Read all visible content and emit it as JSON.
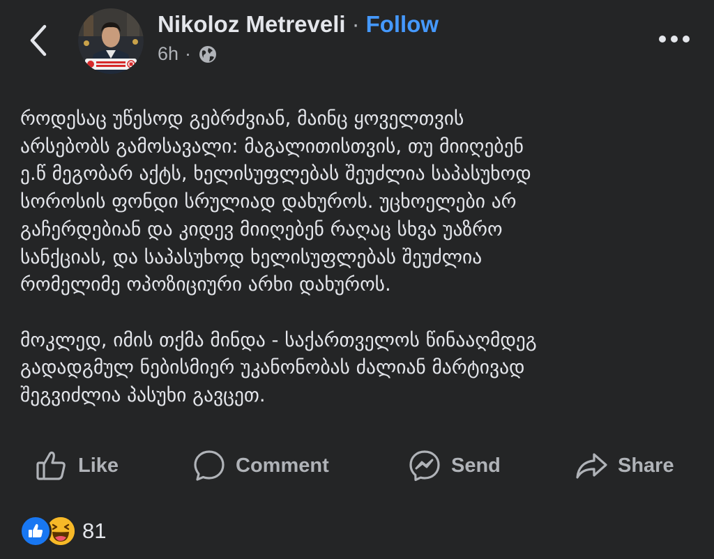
{
  "header": {
    "author_name": "Nikoloz Metreveli",
    "separator": "·",
    "follow_label": "Follow",
    "time": "6h",
    "meta_separator": "·",
    "back_icon": "chevron-left-icon",
    "privacy_icon": "globe-icon",
    "more_icon": "more-horizontal-icon",
    "avatar_badge_text": "ევროპისკენ"
  },
  "post": {
    "paragraphs": [
      "როდესაც უწესოდ გებრძვიან, მაინც ყოველთვის\nარსებობს გამოსავალი: მაგალითისთვის, თუ მიიღებენ\nე.წ მეგობარ აქტს, ხელისუფლებას შეუძლია საპასუხოდ\nსოროსის ფონდი სრულიად დახუროს. უცხოელები არ\nგაჩერდებიან და კიდევ მიიღებენ რაღაც სხვა უაზრო\nსანქციას, და საპასუხოდ ხელისუფლებას შეუძლია\nრომელიმე ოპოზიციური არხი დახუროს.",
      "მოკლედ, იმის თქმა მინდა - საქართველოს წინააღმდეგ\nგადადგმულ ნებისმიერ უკანონობას ძალიან მარტივად\nშეგვიძლია პასუხი გავცეთ."
    ]
  },
  "actions": [
    {
      "label": "Like",
      "icon": "thumbs-up-icon"
    },
    {
      "label": "Comment",
      "icon": "comment-icon"
    },
    {
      "label": "Send",
      "icon": "messenger-icon"
    },
    {
      "label": "Share",
      "icon": "share-icon"
    }
  ],
  "reactions": {
    "types": [
      "like-reaction-icon",
      "haha-reaction-icon"
    ],
    "count": "81"
  },
  "colors": {
    "background": "#242526",
    "text_primary": "#e4e6eb",
    "text_secondary": "#b0b3b8",
    "accent": "#4599ff",
    "like_blue": "#1877f2",
    "haha_yellow": "#f7b928"
  }
}
